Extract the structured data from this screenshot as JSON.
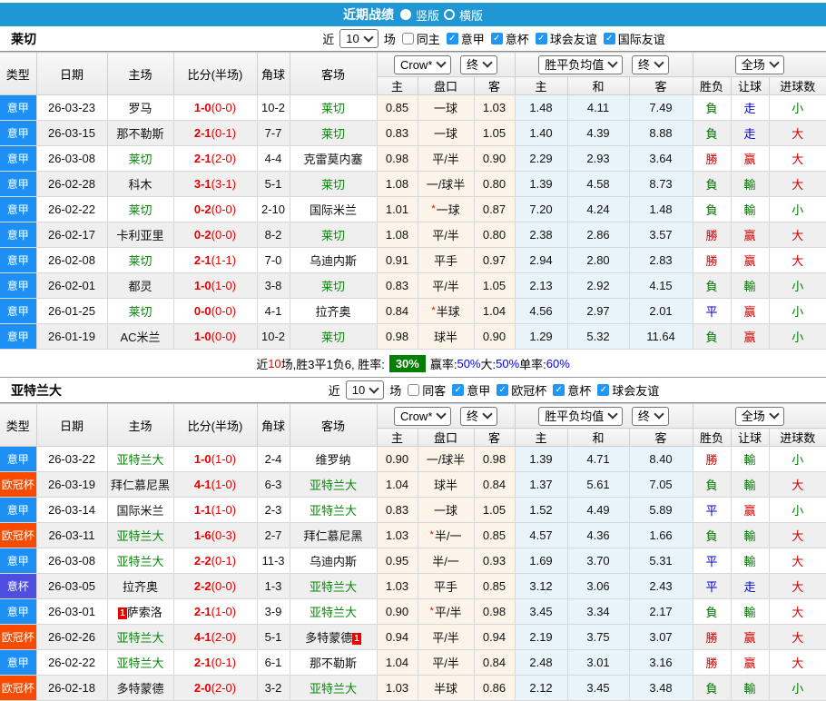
{
  "top_bar": {
    "title": "近期战绩",
    "vertical": "竖版",
    "horizontal": "横版"
  },
  "filter_labels": {
    "near": "近",
    "count": "10",
    "games": "场"
  },
  "columns": [
    "类型",
    "日期",
    "主场",
    "比分(半场)",
    "角球",
    "客场"
  ],
  "odds_columns": [
    "主",
    "盘口",
    "客"
  ],
  "avg_columns": [
    "主",
    "和",
    "客"
  ],
  "result_columns": [
    "胜负",
    "让球",
    "进球数"
  ],
  "selects": {
    "bookmaker": "Crow*",
    "final": "终",
    "avg": "胜平负均值",
    "final2": "终",
    "scope": "全场"
  },
  "colors": {
    "top_bar_blue": "#1E97D4",
    "serie_a_blue": "#1E90F5",
    "ucl_orange": "#F94B00",
    "coppa_purple": "#4E4EE0",
    "win_red": "#D40000",
    "loss_green": "#007800",
    "draw_blue": "#0000D8",
    "team_green": "#088808",
    "score_red": "#E60000",
    "odds_bg": "#FCF4E8",
    "avg_bg": "#E9F3FA",
    "alt_row": "#EFEFEF",
    "summary_badge_green": "#008000",
    "checkbox_blue": "#2196F3"
  },
  "sections": [
    {
      "team": "莱切",
      "filter": {
        "same_label": "同主",
        "same_checked": false,
        "leagues": [
          "意甲",
          "意杯",
          "球会友谊",
          "国际友谊"
        ]
      },
      "rows": [
        {
          "lg": "意甲",
          "lgc": "blue",
          "date": "26-03-23",
          "home": "罗马",
          "hg": false,
          "hb": "",
          "ft": "1-0",
          "ht": "(0-0)",
          "cn": "10-2",
          "away": "莱切",
          "ag": true,
          "ab": "",
          "o1": "0.85",
          "hd": "一球",
          "star": false,
          "o2": "1.03",
          "a1": "1.48",
          "a2": "4.11",
          "a3": "7.49",
          "r1": "負",
          "c1": "g",
          "r2": "走",
          "c2": "b",
          "r3": "小",
          "c3": "g"
        },
        {
          "lg": "意甲",
          "lgc": "blue",
          "date": "26-03-15",
          "home": "那不勒斯",
          "hg": false,
          "hb": "",
          "ft": "2-1",
          "ht": "(0-1)",
          "cn": "7-7",
          "away": "莱切",
          "ag": true,
          "ab": "",
          "o1": "0.83",
          "hd": "一球",
          "star": false,
          "o2": "1.05",
          "a1": "1.40",
          "a2": "4.39",
          "a3": "8.88",
          "r1": "負",
          "c1": "g",
          "r2": "走",
          "c2": "b",
          "r3": "大",
          "c3": "r"
        },
        {
          "lg": "意甲",
          "lgc": "blue",
          "date": "26-03-08",
          "home": "莱切",
          "hg": true,
          "hb": "",
          "ft": "2-1",
          "ht": "(2-0)",
          "cn": "4-4",
          "away": "克雷莫内塞",
          "ag": false,
          "ab": "",
          "o1": "0.98",
          "hd": "平/半",
          "star": false,
          "o2": "0.90",
          "a1": "2.29",
          "a2": "2.93",
          "a3": "3.64",
          "r1": "勝",
          "c1": "r",
          "r2": "赢",
          "c2": "r",
          "r3": "大",
          "c3": "r"
        },
        {
          "lg": "意甲",
          "lgc": "blue",
          "date": "26-02-28",
          "home": "科木",
          "hg": false,
          "hb": "",
          "ft": "3-1",
          "ht": "(3-1)",
          "cn": "5-1",
          "away": "莱切",
          "ag": true,
          "ab": "",
          "o1": "1.08",
          "hd": "一/球半",
          "star": false,
          "o2": "0.80",
          "a1": "1.39",
          "a2": "4.58",
          "a3": "8.73",
          "r1": "負",
          "c1": "g",
          "r2": "輸",
          "c2": "g",
          "r3": "大",
          "c3": "r"
        },
        {
          "lg": "意甲",
          "lgc": "blue",
          "date": "26-02-22",
          "home": "莱切",
          "hg": true,
          "hb": "",
          "ft": "0-2",
          "ht": "(0-0)",
          "cn": "2-10",
          "away": "国际米兰",
          "ag": false,
          "ab": "",
          "o1": "1.01",
          "hd": "一球",
          "star": true,
          "o2": "0.87",
          "a1": "7.20",
          "a2": "4.24",
          "a3": "1.48",
          "r1": "負",
          "c1": "g",
          "r2": "輸",
          "c2": "g",
          "r3": "小",
          "c3": "g"
        },
        {
          "lg": "意甲",
          "lgc": "blue",
          "date": "26-02-17",
          "home": "卡利亚里",
          "hg": false,
          "hb": "",
          "ft": "0-2",
          "ht": "(0-0)",
          "cn": "8-2",
          "away": "莱切",
          "ag": true,
          "ab": "",
          "o1": "1.08",
          "hd": "平/半",
          "star": false,
          "o2": "0.80",
          "a1": "2.38",
          "a2": "2.86",
          "a3": "3.57",
          "r1": "勝",
          "c1": "r",
          "r2": "赢",
          "c2": "r",
          "r3": "大",
          "c3": "r"
        },
        {
          "lg": "意甲",
          "lgc": "blue",
          "date": "26-02-08",
          "home": "莱切",
          "hg": true,
          "hb": "",
          "ft": "2-1",
          "ht": "(1-1)",
          "cn": "7-0",
          "away": "乌迪内斯",
          "ag": false,
          "ab": "",
          "o1": "0.91",
          "hd": "平手",
          "star": false,
          "o2": "0.97",
          "a1": "2.94",
          "a2": "2.80",
          "a3": "2.83",
          "r1": "勝",
          "c1": "r",
          "r2": "赢",
          "c2": "r",
          "r3": "大",
          "c3": "r"
        },
        {
          "lg": "意甲",
          "lgc": "blue",
          "date": "26-02-01",
          "home": "都灵",
          "hg": false,
          "hb": "",
          "ft": "1-0",
          "ht": "(1-0)",
          "cn": "3-8",
          "away": "莱切",
          "ag": true,
          "ab": "",
          "o1": "0.83",
          "hd": "平/半",
          "star": false,
          "o2": "1.05",
          "a1": "2.13",
          "a2": "2.92",
          "a3": "4.15",
          "r1": "負",
          "c1": "g",
          "r2": "輸",
          "c2": "g",
          "r3": "小",
          "c3": "g"
        },
        {
          "lg": "意甲",
          "lgc": "blue",
          "date": "26-01-25",
          "home": "莱切",
          "hg": true,
          "hb": "",
          "ft": "0-0",
          "ht": "(0-0)",
          "cn": "4-1",
          "away": "拉齐奥",
          "ag": false,
          "ab": "",
          "o1": "0.84",
          "hd": "半球",
          "star": true,
          "o2": "1.04",
          "a1": "4.56",
          "a2": "2.97",
          "a3": "2.01",
          "r1": "平",
          "c1": "b",
          "r2": "赢",
          "c2": "r",
          "r3": "小",
          "c3": "g"
        },
        {
          "lg": "意甲",
          "lgc": "blue",
          "date": "26-01-19",
          "home": "AC米兰",
          "hg": false,
          "hb": "",
          "ft": "1-0",
          "ht": "(0-0)",
          "cn": "10-2",
          "away": "莱切",
          "ag": true,
          "ab": "",
          "o1": "0.98",
          "hd": "球半",
          "star": false,
          "o2": "0.90",
          "a1": "1.29",
          "a2": "5.32",
          "a3": "11.64",
          "r1": "負",
          "c1": "g",
          "r2": "赢",
          "c2": "r",
          "r3": "小",
          "c3": "g"
        }
      ],
      "summary_parts": [
        {
          "t": "近"
        },
        {
          "t": "10",
          "c": "red"
        },
        {
          "t": "场,胜3平1负6, 胜率:"
        },
        {
          "t": "30%",
          "c": "badge"
        },
        {
          "t": "赢率:"
        },
        {
          "t": "50%",
          "c": "blue"
        },
        {
          "t": " 大:"
        },
        {
          "t": "50%",
          "c": "blue"
        },
        {
          "t": " 单率:"
        },
        {
          "t": "60%",
          "c": "blue"
        }
      ]
    },
    {
      "team": "亚特兰大",
      "filter": {
        "same_label": "同客",
        "same_checked": false,
        "leagues": [
          "意甲",
          "欧冠杯",
          "意杯",
          "球会友谊"
        ]
      },
      "rows": [
        {
          "lg": "意甲",
          "lgc": "blue",
          "date": "26-03-22",
          "home": "亚特兰大",
          "hg": true,
          "hb": "",
          "ft": "1-0",
          "ht": "(1-0)",
          "cn": "2-4",
          "away": "维罗纳",
          "ag": false,
          "ab": "",
          "o1": "0.90",
          "hd": "一/球半",
          "star": false,
          "o2": "0.98",
          "a1": "1.39",
          "a2": "4.71",
          "a3": "8.40",
          "r1": "勝",
          "c1": "r",
          "r2": "輸",
          "c2": "g",
          "r3": "小",
          "c3": "g"
        },
        {
          "lg": "欧冠杯",
          "lgc": "orange",
          "date": "26-03-19",
          "home": "拜仁慕尼黑",
          "hg": false,
          "hb": "",
          "ft": "4-1",
          "ht": "(1-0)",
          "cn": "6-3",
          "away": "亚特兰大",
          "ag": true,
          "ab": "",
          "o1": "1.04",
          "hd": "球半",
          "star": false,
          "o2": "0.84",
          "a1": "1.37",
          "a2": "5.61",
          "a3": "7.05",
          "r1": "負",
          "c1": "g",
          "r2": "輸",
          "c2": "g",
          "r3": "大",
          "c3": "r"
        },
        {
          "lg": "意甲",
          "lgc": "blue",
          "date": "26-03-14",
          "home": "国际米兰",
          "hg": false,
          "hb": "",
          "ft": "1-1",
          "ht": "(1-0)",
          "cn": "2-3",
          "away": "亚特兰大",
          "ag": true,
          "ab": "",
          "o1": "0.83",
          "hd": "一球",
          "star": false,
          "o2": "1.05",
          "a1": "1.52",
          "a2": "4.49",
          "a3": "5.89",
          "r1": "平",
          "c1": "b",
          "r2": "赢",
          "c2": "r",
          "r3": "小",
          "c3": "g"
        },
        {
          "lg": "欧冠杯",
          "lgc": "orange",
          "date": "26-03-11",
          "home": "亚特兰大",
          "hg": true,
          "hb": "",
          "ft": "1-6",
          "ht": "(0-3)",
          "cn": "2-7",
          "away": "拜仁慕尼黑",
          "ag": false,
          "ab": "",
          "o1": "1.03",
          "hd": "半/一",
          "star": true,
          "o2": "0.85",
          "a1": "4.57",
          "a2": "4.36",
          "a3": "1.66",
          "r1": "負",
          "c1": "g",
          "r2": "輸",
          "c2": "g",
          "r3": "大",
          "c3": "r"
        },
        {
          "lg": "意甲",
          "lgc": "blue",
          "date": "26-03-08",
          "home": "亚特兰大",
          "hg": true,
          "hb": "",
          "ft": "2-2",
          "ht": "(0-1)",
          "cn": "11-3",
          "away": "乌迪内斯",
          "ag": false,
          "ab": "",
          "o1": "0.95",
          "hd": "半/一",
          "star": false,
          "o2": "0.93",
          "a1": "1.69",
          "a2": "3.70",
          "a3": "5.31",
          "r1": "平",
          "c1": "b",
          "r2": "輸",
          "c2": "g",
          "r3": "大",
          "c3": "r"
        },
        {
          "lg": "意杯",
          "lgc": "purple",
          "date": "26-03-05",
          "home": "拉齐奥",
          "hg": false,
          "hb": "",
          "ft": "2-2",
          "ht": "(0-0)",
          "cn": "1-3",
          "away": "亚特兰大",
          "ag": true,
          "ab": "",
          "o1": "1.03",
          "hd": "平手",
          "star": false,
          "o2": "0.85",
          "a1": "3.12",
          "a2": "3.06",
          "a3": "2.43",
          "r1": "平",
          "c1": "b",
          "r2": "走",
          "c2": "b",
          "r3": "大",
          "c3": "r"
        },
        {
          "lg": "意甲",
          "lgc": "blue",
          "date": "26-03-01",
          "home": "萨索洛",
          "hg": false,
          "hb": "1",
          "ft": "2-1",
          "ht": "(1-0)",
          "cn": "3-9",
          "away": "亚特兰大",
          "ag": true,
          "ab": "",
          "o1": "0.90",
          "hd": "平/半",
          "star": true,
          "o2": "0.98",
          "a1": "3.45",
          "a2": "3.34",
          "a3": "2.17",
          "r1": "負",
          "c1": "g",
          "r2": "輸",
          "c2": "g",
          "r3": "大",
          "c3": "r"
        },
        {
          "lg": "欧冠杯",
          "lgc": "orange",
          "date": "26-02-26",
          "home": "亚特兰大",
          "hg": true,
          "hb": "",
          "ft": "4-1",
          "ht": "(2-0)",
          "cn": "5-1",
          "away": "多特蒙德",
          "ag": false,
          "ab": "1",
          "o1": "0.94",
          "hd": "平/半",
          "star": false,
          "o2": "0.94",
          "a1": "2.19",
          "a2": "3.75",
          "a3": "3.07",
          "r1": "勝",
          "c1": "r",
          "r2": "赢",
          "c2": "r",
          "r3": "大",
          "c3": "r"
        },
        {
          "lg": "意甲",
          "lgc": "blue",
          "date": "26-02-22",
          "home": "亚特兰大",
          "hg": true,
          "hb": "",
          "ft": "2-1",
          "ht": "(0-1)",
          "cn": "6-1",
          "away": "那不勒斯",
          "ag": false,
          "ab": "",
          "o1": "1.04",
          "hd": "平/半",
          "star": false,
          "o2": "0.84",
          "a1": "2.48",
          "a2": "3.01",
          "a3": "3.16",
          "r1": "勝",
          "c1": "r",
          "r2": "赢",
          "c2": "r",
          "r3": "大",
          "c3": "r"
        },
        {
          "lg": "欧冠杯",
          "lgc": "orange",
          "date": "26-02-18",
          "home": "多特蒙德",
          "hg": false,
          "hb": "",
          "ft": "2-0",
          "ht": "(2-0)",
          "cn": "3-2",
          "away": "亚特兰大",
          "ag": true,
          "ab": "",
          "o1": "1.03",
          "hd": "半球",
          "star": false,
          "o2": "0.86",
          "a1": "2.12",
          "a2": "3.45",
          "a3": "3.48",
          "r1": "負",
          "c1": "g",
          "r2": "輸",
          "c2": "g",
          "r3": "小",
          "c3": "g"
        }
      ]
    }
  ]
}
